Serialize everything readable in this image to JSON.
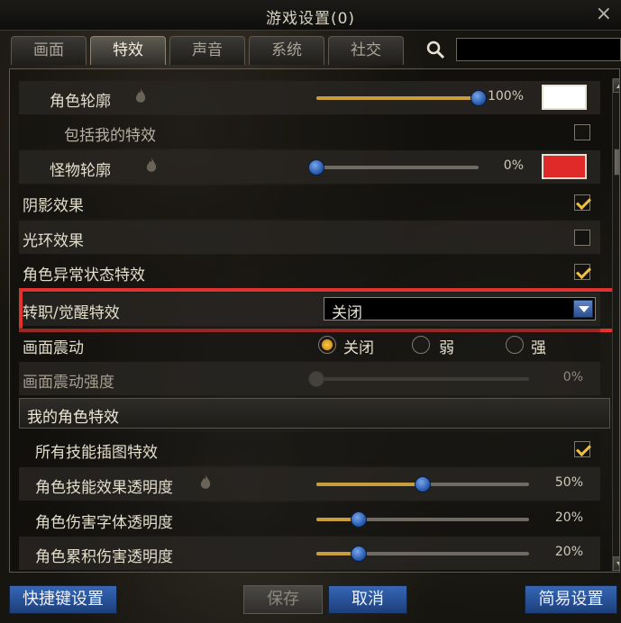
{
  "window": {
    "title": "游戏设置(0)",
    "close": "×"
  },
  "tabs": [
    {
      "label": "画面",
      "active": false
    },
    {
      "label": "特效",
      "active": true
    },
    {
      "label": "声音",
      "active": false
    },
    {
      "label": "系统",
      "active": false
    },
    {
      "label": "社交",
      "active": false
    }
  ],
  "search": {
    "value": "",
    "placeholder": ""
  },
  "settings": {
    "character_outline": {
      "label": "角色轮廓",
      "value_pct": 100,
      "value_text": "100%",
      "color": "#ffffff"
    },
    "include_my_effects": {
      "label": "包括我的特效",
      "checked": false
    },
    "monster_outline": {
      "label": "怪物轮廓",
      "value_pct": 0,
      "value_text": "0%",
      "color": "#e02a2a"
    },
    "shadow_effect": {
      "label": "阴影效果",
      "checked": true
    },
    "halo_effect": {
      "label": "光环效果",
      "checked": false
    },
    "abnormal_status_effect": {
      "label": "角色异常状态特效",
      "checked": true
    },
    "awakening_effect": {
      "label": "转职/觉醒特效",
      "selected": "关闭"
    },
    "screen_shake": {
      "label": "画面震动",
      "options": [
        "关闭",
        "弱",
        "强"
      ],
      "selected_index": 0
    },
    "screen_shake_strength": {
      "label": "画面震动强度",
      "value_pct": 0,
      "value_text": "0%"
    }
  },
  "my_character_section": {
    "title": "我的角色特效",
    "all_skill_cutin": {
      "label": "所有技能插图特效",
      "checked": true
    },
    "skill_effect_transparency": {
      "label": "角色技能效果透明度",
      "value_pct": 50,
      "value_text": "50%"
    },
    "damage_font_transparency": {
      "label": "角色伤害字体透明度",
      "value_pct": 20,
      "value_text": "20%"
    },
    "cumulative_damage_transparency": {
      "label": "角色累积伤害透明度",
      "value_pct": 20,
      "value_text": "20%"
    }
  },
  "buttons": {
    "shortcut": "快捷键设置",
    "save": "保存",
    "cancel": "取消",
    "simple": "简易设置"
  },
  "colors": {
    "accent_gold": "#c99d3b",
    "highlight_red": "#e0322f",
    "button_blue": "#2a56a0"
  }
}
